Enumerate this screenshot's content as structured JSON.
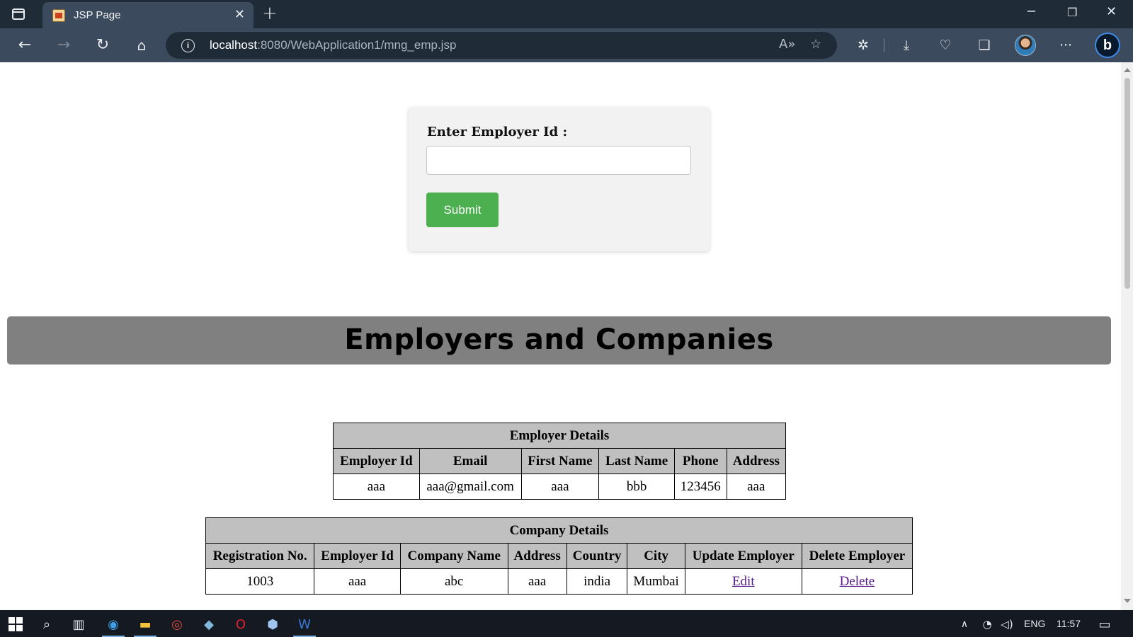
{
  "browser": {
    "tab_title": "JSP Page",
    "url_host": "localhost",
    "url_path": ":8080/WebApplication1/mng_emp.jsp"
  },
  "form": {
    "label": "Enter Employer Id :",
    "input_value": "",
    "submit_label": "Submit"
  },
  "banner": {
    "title": "Employers and Companies"
  },
  "employer_table": {
    "caption": "Employer Details",
    "headers": [
      "Employer Id",
      "Email",
      "First Name",
      "Last Name",
      "Phone",
      "Address"
    ],
    "rows": [
      [
        "aaa",
        "aaa@gmail.com",
        "aaa",
        "bbb",
        "123456",
        "aaa"
      ]
    ]
  },
  "company_table": {
    "caption": "Company Details",
    "headers": [
      "Registration No.",
      "Employer Id",
      "Company Name",
      "Address",
      "Country",
      "City",
      "Update Employer",
      "Delete Employer"
    ],
    "rows": [
      [
        "1003",
        "aaa",
        "abc",
        "aaa",
        "india",
        "Mumbai",
        "Edit",
        "Delete"
      ]
    ]
  },
  "taskbar": {
    "language": "ENG",
    "time": "11:57"
  },
  "colors": {
    "submit": "#4caf50",
    "banner": "#808080",
    "table_header": "#c0c0c0",
    "link": "#551a8b"
  }
}
